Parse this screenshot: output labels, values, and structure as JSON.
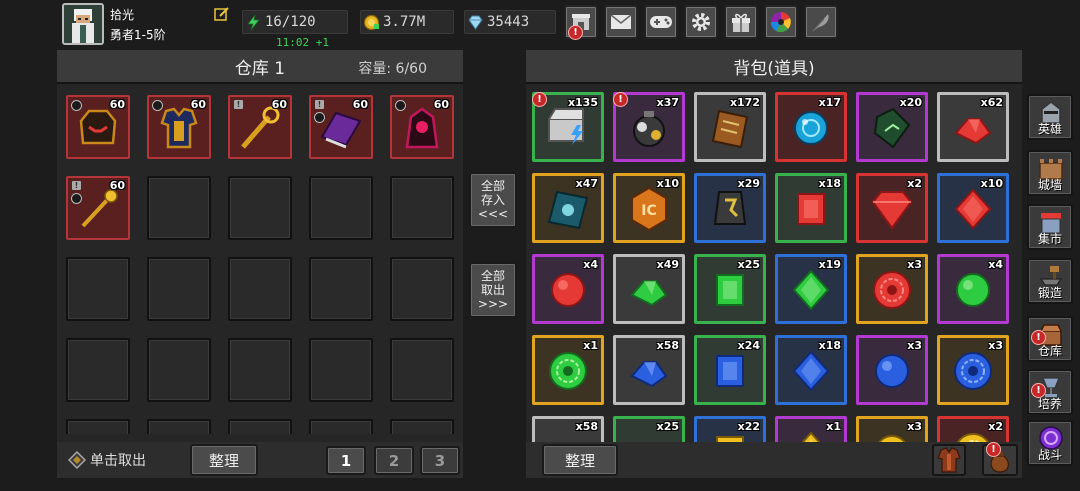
{
  "player": {
    "name": "拾光",
    "rank": "勇者1-5阶"
  },
  "resources": {
    "energy": "16/120",
    "energy_regen": "11:02 +1",
    "gold": "3.77M",
    "gems": "35443"
  },
  "top_buttons": [
    {
      "icon": "shop-icon",
      "badge": "!"
    },
    {
      "icon": "mail-icon"
    },
    {
      "icon": "gamepad-icon"
    },
    {
      "icon": "gear-icon"
    },
    {
      "icon": "gift-icon"
    },
    {
      "icon": "color-wheel-icon"
    },
    {
      "icon": "feather-icon"
    }
  ],
  "warehouse": {
    "title": "仓库 1",
    "capacity_label": "容量: 6/60",
    "items": [
      {
        "icon": "dark-helmet-icon",
        "qty": "60",
        "marker": "circle"
      },
      {
        "icon": "armor-icon",
        "qty": "60",
        "marker": "circle"
      },
      {
        "icon": "golden-staff-icon",
        "qty": "60",
        "marker": "lock"
      },
      {
        "icon": "spellbook-icon",
        "qty": "60",
        "marker": "lock-circle"
      },
      {
        "icon": "dark-cloak-icon",
        "qty": "60",
        "marker": "circle"
      },
      {
        "icon": "golden-scepter-icon",
        "qty": "60",
        "marker": "lock-circle"
      }
    ],
    "take_on_click_label": "单击取出",
    "sort_label": "整理",
    "pages": [
      "1",
      "2",
      "3"
    ],
    "current_page": "1"
  },
  "transfer": {
    "store_all": [
      "全部",
      "存入",
      "<<<"
    ],
    "take_all": [
      "全部",
      "取出",
      ">>>"
    ]
  },
  "bag": {
    "title": "背包(道具)",
    "sort_label": "整理",
    "items": [
      {
        "icon": "treasure-chest-icon",
        "qty": "x135",
        "frame": "#37b24d",
        "bg": "#2f3b33",
        "alert": true
      },
      {
        "icon": "loot-bag-icon",
        "qty": "x37",
        "frame": "#b33ad1",
        "bg": "#3a2a3e",
        "alert": true
      },
      {
        "icon": "tome-icon",
        "qty": "x172",
        "frame": "#bdbdbd",
        "bg": "#3a3a3a"
      },
      {
        "icon": "blue-orb-icon",
        "qty": "x17",
        "frame": "#d83333",
        "bg": "#4a2424"
      },
      {
        "icon": "green-scroll-icon",
        "qty": "x20",
        "frame": "#b33ad1",
        "bg": "#3a2a3e"
      },
      {
        "icon": "red-shard-icon",
        "qty": "x62",
        "frame": "#bdbdbd",
        "bg": "#3a3a3a"
      },
      {
        "icon": "blue-book-icon",
        "qty": "x47",
        "frame": "#e0a420",
        "bg": "#3d3322"
      },
      {
        "icon": "orange-rune-icon",
        "qty": "x10",
        "frame": "#e0a420",
        "bg": "#3d3322"
      },
      {
        "icon": "dark-rune-icon",
        "qty": "x29",
        "frame": "#2f6fd8",
        "bg": "#273247"
      },
      {
        "icon": "red-cube-icon",
        "qty": "x18",
        "frame": "#37b24d",
        "bg": "#2f3b33"
      },
      {
        "icon": "large-ruby-icon",
        "qty": "x2",
        "frame": "#d83333",
        "bg": "#4a2424"
      },
      {
        "icon": "red-diamond-icon",
        "qty": "x10",
        "frame": "#2f6fd8",
        "bg": "#273247"
      },
      {
        "icon": "red-round-gem-icon",
        "qty": "x4",
        "frame": "#b33ad1",
        "bg": "#3a2a3e"
      },
      {
        "icon": "green-shard-icon",
        "qty": "x49",
        "frame": "#bdbdbd",
        "bg": "#3a3a3a"
      },
      {
        "icon": "green-cube-icon",
        "qty": "x25",
        "frame": "#37b24d",
        "bg": "#2f3b33"
      },
      {
        "icon": "green-diamond-icon",
        "qty": "x19",
        "frame": "#2f6fd8",
        "bg": "#273247"
      },
      {
        "icon": "red-faceted-gem-icon",
        "qty": "x3",
        "frame": "#e0a420",
        "bg": "#3d3322"
      },
      {
        "icon": "green-round-gem-icon",
        "qty": "x4",
        "frame": "#b33ad1",
        "bg": "#3a2a3e"
      },
      {
        "icon": "green-faceted-gem-icon",
        "qty": "x1",
        "frame": "#e0a420",
        "bg": "#3d3322"
      },
      {
        "icon": "blue-shard-icon",
        "qty": "x58",
        "frame": "#bdbdbd",
        "bg": "#3a3a3a"
      },
      {
        "icon": "blue-cube-icon",
        "qty": "x24",
        "frame": "#37b24d",
        "bg": "#2f3b33"
      },
      {
        "icon": "blue-diamond-icon",
        "qty": "x18",
        "frame": "#2f6fd8",
        "bg": "#273247"
      },
      {
        "icon": "blue-round-gem-icon",
        "qty": "x3",
        "frame": "#b33ad1",
        "bg": "#3a2a3e"
      },
      {
        "icon": "blue-faceted-gem-icon",
        "qty": "x3",
        "frame": "#e0a420",
        "bg": "#3d3322"
      },
      {
        "icon": "white-shard-icon",
        "qty": "x58",
        "frame": "#bdbdbd",
        "bg": "#3a3a3a"
      },
      {
        "icon": "yellow-shard-icon",
        "qty": "x25",
        "frame": "#37b24d",
        "bg": "#2f3b33"
      },
      {
        "icon": "yellow-cube-icon",
        "qty": "x22",
        "frame": "#2f6fd8",
        "bg": "#273247"
      },
      {
        "icon": "yellow-diamond-icon",
        "qty": "x1",
        "frame": "#b33ad1",
        "bg": "#3a2a3e"
      },
      {
        "icon": "yellow-round-gem-icon",
        "qty": "x3",
        "frame": "#e0a420",
        "bg": "#3d3322"
      },
      {
        "icon": "yellow-faceted-gem-icon",
        "qty": "x2",
        "frame": "#d83333",
        "bg": "#4a2424"
      }
    ]
  },
  "sidebar": [
    {
      "label": "英雄",
      "icon": "knight-helmet-icon"
    },
    {
      "label": "城墙",
      "icon": "castle-wall-icon"
    },
    {
      "label": "集市",
      "icon": "market-icon"
    },
    {
      "label": "锻造",
      "icon": "anvil-hammer-icon"
    },
    {
      "label": "仓库",
      "icon": "warehouse-chest-icon",
      "alert": true
    },
    {
      "label": "培养",
      "icon": "chalice-icon",
      "alert": true
    },
    {
      "label": "战斗",
      "icon": "portal-icon"
    }
  ],
  "quick_items": [
    {
      "icon": "leather-armor-icon"
    },
    {
      "icon": "pouch-icon",
      "alert": true
    }
  ],
  "colors": {
    "accent_gold": "#e0a420",
    "regen_green": "#3fd35a",
    "alert_red": "#c62828"
  }
}
